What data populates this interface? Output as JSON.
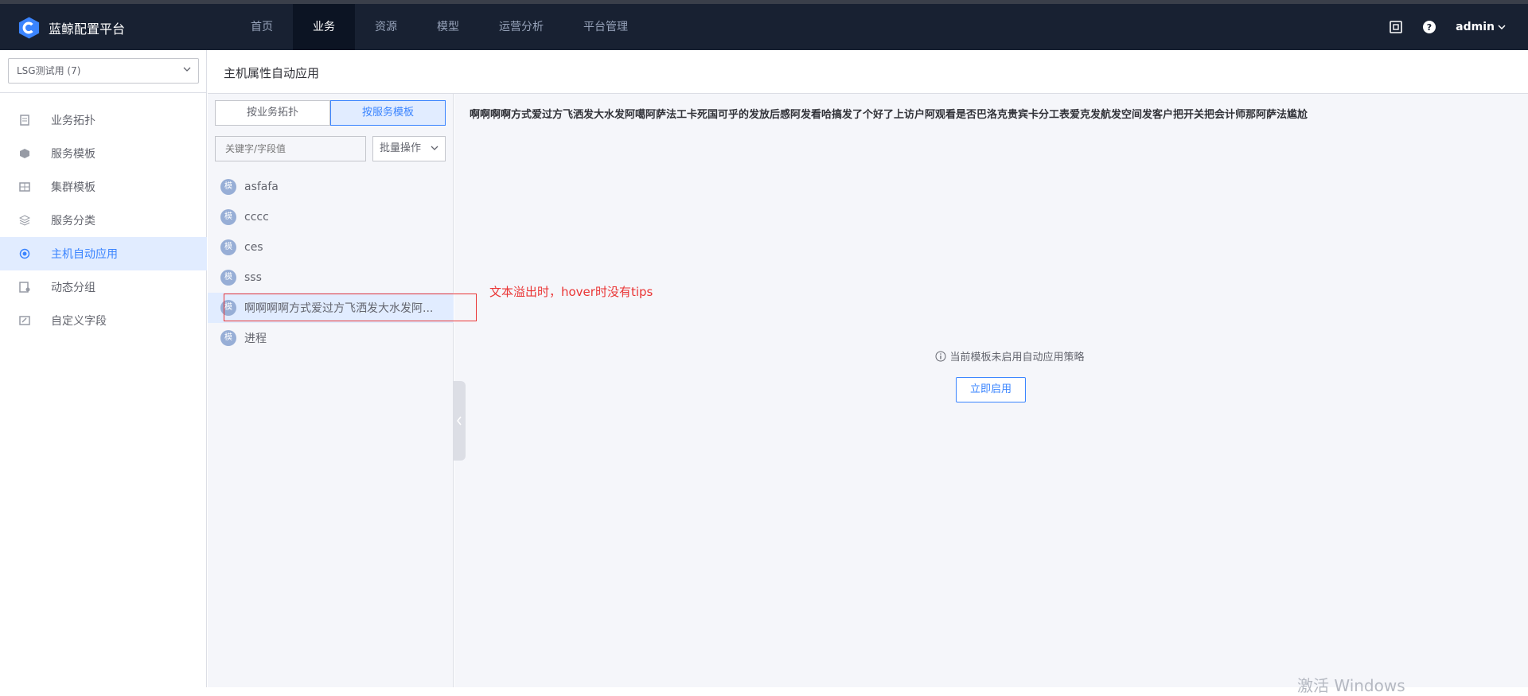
{
  "app": {
    "title": "蓝鲸配置平台",
    "accent": "#3a84ff",
    "nav_bg": "#182132"
  },
  "nav": {
    "items": [
      {
        "label": "首页",
        "active": false
      },
      {
        "label": "业务",
        "active": true
      },
      {
        "label": "资源",
        "active": false
      },
      {
        "label": "模型",
        "active": false
      },
      {
        "label": "运营分析",
        "active": false
      },
      {
        "label": "平台管理",
        "active": false
      }
    ],
    "user": "admin",
    "icons": [
      "screen-icon",
      "help-icon"
    ]
  },
  "sidebar": {
    "business_select": "LSG测试用 (7)",
    "items": [
      {
        "label": "业务拓扑",
        "icon": "topology-icon",
        "active": false
      },
      {
        "label": "服务模板",
        "icon": "service-template-icon",
        "active": false
      },
      {
        "label": "集群模板",
        "icon": "cluster-template-icon",
        "active": false
      },
      {
        "label": "服务分类",
        "icon": "service-category-icon",
        "active": false
      },
      {
        "label": "主机自动应用",
        "icon": "host-auto-apply-icon",
        "active": true
      },
      {
        "label": "动态分组",
        "icon": "dynamic-group-icon",
        "active": false
      },
      {
        "label": "自定义字段",
        "icon": "custom-field-icon",
        "active": false
      }
    ]
  },
  "page": {
    "title": "主机属性自动应用"
  },
  "template_panel": {
    "tabs": [
      {
        "label": "按业务拓扑",
        "active": false
      },
      {
        "label": "按服务模板",
        "active": true
      }
    ],
    "search_placeholder": "关键字/字段值",
    "batch_label": "批量操作",
    "badge": "模",
    "items": [
      {
        "name": "asfafa",
        "active": false
      },
      {
        "name": "cccc",
        "active": false
      },
      {
        "name": "ces",
        "active": false
      },
      {
        "name": "sss",
        "active": false
      },
      {
        "name": "啊啊啊啊方式爱过方飞洒发大水发阿噶阿萨法工卡死国可乎的发放后感阿发看哈搞发了个好了上访户阿观看是否巴洛克贵宾卡分工表爱克发航发空间发客户把开关把会计师那阿萨法尴尬",
        "display": "啊啊啊啊方式爱过方飞洒发大水发阿...",
        "active": true
      },
      {
        "name": "进程",
        "active": false
      }
    ]
  },
  "annotation": {
    "text": "文本溢出时，hover时没有tips"
  },
  "main": {
    "template_title": "啊啊啊啊方式爱过方飞洒发大水发阿噶阿萨法工卡死国可乎的发放后感阿发看哈搞发了个好了上访户阿观看是否巴洛克贵宾卡分工表爱克发航发空间发客户把开关把会计师那阿萨法尴尬",
    "empty_tip": "当前模板未启用自动应用策略",
    "enable_button": "立即启用"
  },
  "watermark": "激活 Windows"
}
